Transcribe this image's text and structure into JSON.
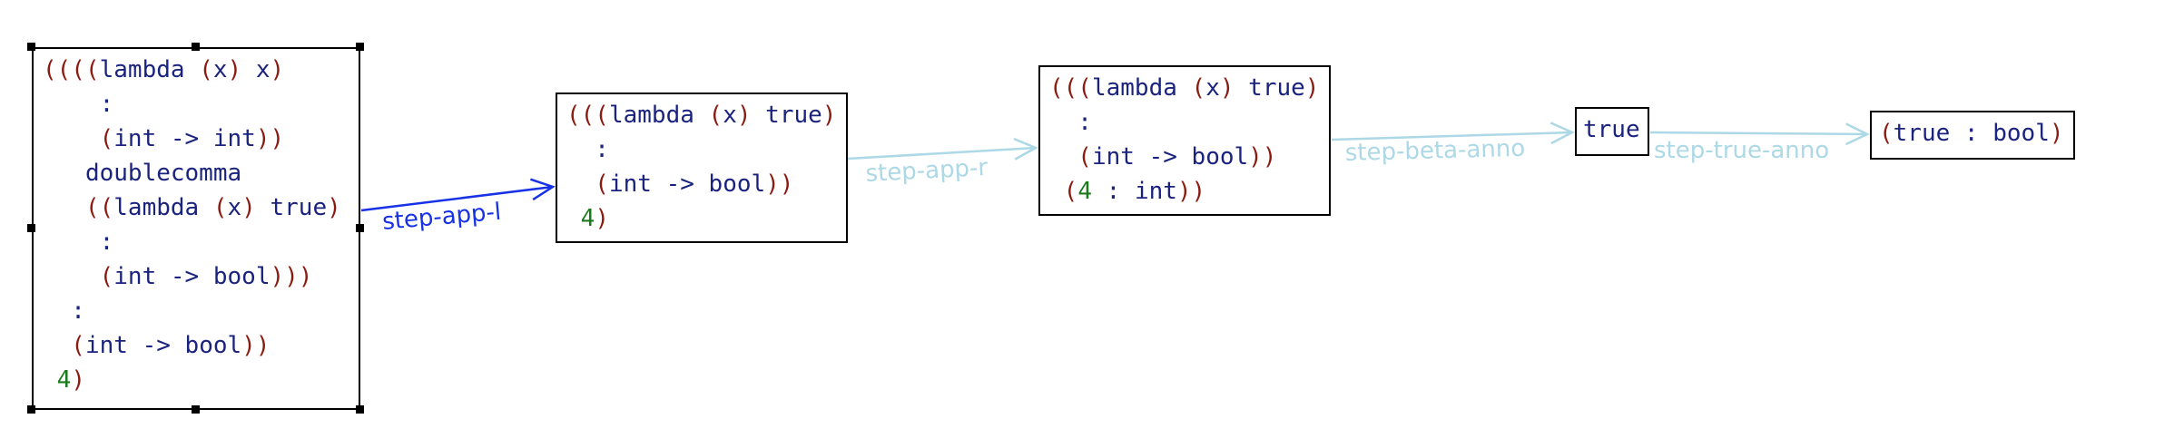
{
  "colors": {
    "paren": "#8b1a10",
    "keyword": "#1a237e",
    "number": "#1b7a1b",
    "edge_active": "#1732e6",
    "edge_inactive": "#add8e6"
  },
  "nodes": [
    {
      "id": "term-1",
      "selected": true,
      "lines": [
        [
          {
            "t": "((((",
            "c": "paren"
          },
          {
            "t": "lambda",
            "c": "keyword"
          },
          {
            "t": " ",
            "c": "keyword"
          },
          {
            "t": "(",
            "c": "paren"
          },
          {
            "t": "x",
            "c": "keyword"
          },
          {
            "t": ")",
            "c": "paren"
          },
          {
            "t": " x",
            "c": "keyword"
          },
          {
            "t": ")",
            "c": "paren"
          }
        ],
        [
          {
            "t": "    :",
            "c": "keyword"
          }
        ],
        [
          {
            "t": "    (",
            "c": "paren"
          },
          {
            "t": "int -> int",
            "c": "keyword"
          },
          {
            "t": "))",
            "c": "paren"
          }
        ],
        [
          {
            "t": "   doublecomma",
            "c": "keyword"
          }
        ],
        [
          {
            "t": "   ((",
            "c": "paren"
          },
          {
            "t": "lambda",
            "c": "keyword"
          },
          {
            "t": " ",
            "c": "keyword"
          },
          {
            "t": "(",
            "c": "paren"
          },
          {
            "t": "x",
            "c": "keyword"
          },
          {
            "t": ")",
            "c": "paren"
          },
          {
            "t": " true",
            "c": "keyword"
          },
          {
            "t": ")",
            "c": "paren"
          }
        ],
        [
          {
            "t": "    :",
            "c": "keyword"
          }
        ],
        [
          {
            "t": "    (",
            "c": "paren"
          },
          {
            "t": "int -> bool",
            "c": "keyword"
          },
          {
            "t": ")))",
            "c": "paren"
          }
        ],
        [
          {
            "t": "  :",
            "c": "keyword"
          }
        ],
        [
          {
            "t": "  (",
            "c": "paren"
          },
          {
            "t": "int -> bool",
            "c": "keyword"
          },
          {
            "t": "))",
            "c": "paren"
          }
        ],
        [
          {
            "t": " ",
            "c": "keyword"
          },
          {
            "t": "4",
            "c": "number"
          },
          {
            "t": ")",
            "c": "paren"
          }
        ]
      ]
    },
    {
      "id": "term-2",
      "selected": false,
      "lines": [
        [
          {
            "t": "(((",
            "c": "paren"
          },
          {
            "t": "lambda",
            "c": "keyword"
          },
          {
            "t": " ",
            "c": "keyword"
          },
          {
            "t": "(",
            "c": "paren"
          },
          {
            "t": "x",
            "c": "keyword"
          },
          {
            "t": ")",
            "c": "paren"
          },
          {
            "t": " true",
            "c": "keyword"
          },
          {
            "t": ")",
            "c": "paren"
          }
        ],
        [
          {
            "t": "  :",
            "c": "keyword"
          }
        ],
        [
          {
            "t": "  (",
            "c": "paren"
          },
          {
            "t": "int -> bool",
            "c": "keyword"
          },
          {
            "t": "))",
            "c": "paren"
          }
        ],
        [
          {
            "t": " ",
            "c": "keyword"
          },
          {
            "t": "4",
            "c": "number"
          },
          {
            "t": ")",
            "c": "paren"
          }
        ]
      ]
    },
    {
      "id": "term-3",
      "selected": false,
      "lines": [
        [
          {
            "t": "(((",
            "c": "paren"
          },
          {
            "t": "lambda",
            "c": "keyword"
          },
          {
            "t": " ",
            "c": "keyword"
          },
          {
            "t": "(",
            "c": "paren"
          },
          {
            "t": "x",
            "c": "keyword"
          },
          {
            "t": ")",
            "c": "paren"
          },
          {
            "t": " true",
            "c": "keyword"
          },
          {
            "t": ")",
            "c": "paren"
          }
        ],
        [
          {
            "t": "  :",
            "c": "keyword"
          }
        ],
        [
          {
            "t": "  (",
            "c": "paren"
          },
          {
            "t": "int -> bool",
            "c": "keyword"
          },
          {
            "t": "))",
            "c": "paren"
          }
        ],
        [
          {
            "t": " (",
            "c": "paren"
          },
          {
            "t": "4",
            "c": "number"
          },
          {
            "t": " : ",
            "c": "keyword"
          },
          {
            "t": "int",
            "c": "keyword"
          },
          {
            "t": "))",
            "c": "paren"
          }
        ]
      ]
    },
    {
      "id": "term-4",
      "selected": false,
      "lines": [
        [
          {
            "t": "true",
            "c": "keyword"
          }
        ]
      ]
    },
    {
      "id": "term-5",
      "selected": false,
      "lines": [
        [
          {
            "t": "(",
            "c": "paren"
          },
          {
            "t": "true : bool",
            "c": "keyword"
          },
          {
            "t": ")",
            "c": "paren"
          }
        ]
      ]
    }
  ],
  "edges": [
    {
      "id": "edge-step-app-l",
      "label": "step-app-l",
      "active": true,
      "from": 0,
      "to": 1
    },
    {
      "id": "edge-step-app-r",
      "label": "step-app-r",
      "active": false,
      "from": 1,
      "to": 2
    },
    {
      "id": "edge-step-beta-anno",
      "label": "step-beta-anno",
      "active": false,
      "from": 2,
      "to": 3
    },
    {
      "id": "edge-step-true-anno",
      "label": "step-true-anno",
      "active": false,
      "from": 3,
      "to": 4
    }
  ]
}
